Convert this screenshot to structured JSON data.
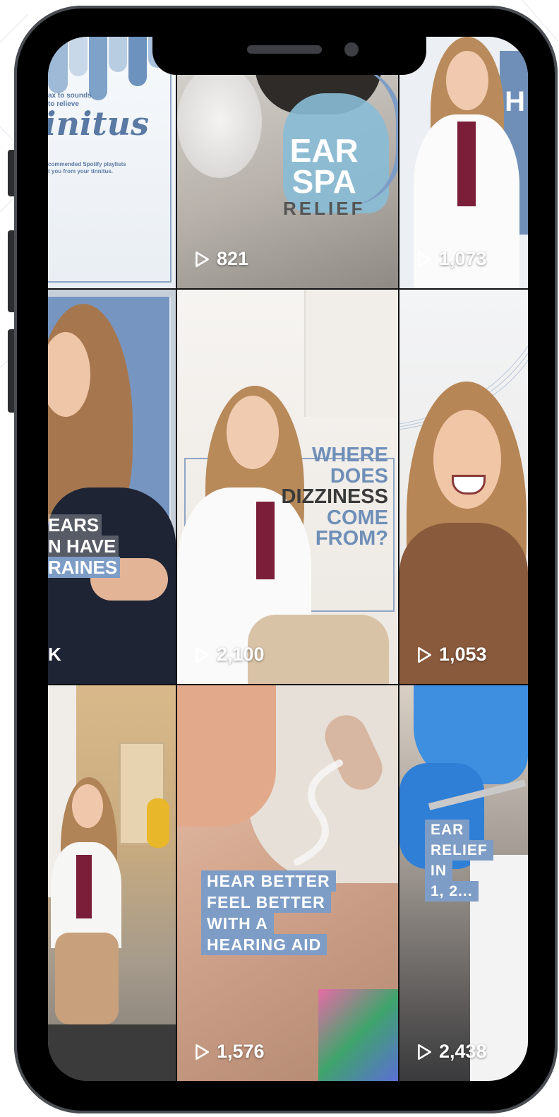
{
  "tiles": [
    {
      "name": "tinnitus-tile",
      "small_text_1": "ax to sounds",
      "small_text_2": "to relieve",
      "title": "initus",
      "footnote_1": "commended Spotify playlists",
      "footnote_2": "t you from your tinnitus.",
      "views": ""
    },
    {
      "name": "ear-spa-tile",
      "headline_1": "EAR",
      "headline_2": "SPA",
      "subline": "RELIEF",
      "views": "821"
    },
    {
      "name": "doctor-white-coat-tile",
      "corner_letter": "H",
      "views": "1,073"
    },
    {
      "name": "migraines-tile",
      "line_1": "EARS",
      "line_2": "N HAVE",
      "line_3": "RAINES",
      "bottom_char": "K",
      "views": ""
    },
    {
      "name": "dizziness-tile",
      "line_1": "WHERE",
      "line_2": "DOES",
      "line_3": "DIZZINESS",
      "line_4": "COME",
      "line_5": "FROM?",
      "views": "2,100"
    },
    {
      "name": "excited-woman-tile",
      "views": "1,053"
    },
    {
      "name": "living-room-tile",
      "views": ""
    },
    {
      "name": "hearing-aid-tile",
      "line_1": "HEAR BETTER",
      "line_2": "FEEL BETTER",
      "line_3": "WITH A",
      "line_4": "HEARING AID",
      "views": "1,576"
    },
    {
      "name": "ear-relief-tile",
      "line_1": "EAR",
      "line_2": "RELIEF",
      "line_3": "IN",
      "line_4": "1, 2...",
      "views": "2,438"
    }
  ],
  "icons": {
    "play": "play-outline-icon"
  },
  "colors": {
    "brand_blue": "#7e9dc6",
    "frame": "#000000"
  }
}
